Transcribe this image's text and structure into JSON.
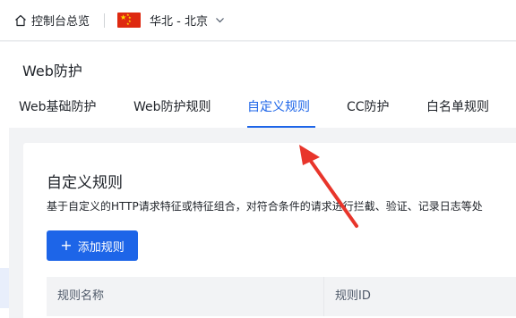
{
  "topbar": {
    "home_label": "控制台总览",
    "region_label": "华北 - 北京"
  },
  "page": {
    "title": "Web防护"
  },
  "tabs": [
    {
      "label": "Web基础防护",
      "active": false
    },
    {
      "label": "Web防护规则",
      "active": false
    },
    {
      "label": "自定义规则",
      "active": true
    },
    {
      "label": "CC防护",
      "active": false
    },
    {
      "label": "白名单规则",
      "active": false
    }
  ],
  "card": {
    "title": "自定义规则",
    "description": "基于自定义的HTTP请求特征或特征组合，对符合条件的请求进行拦截、验证、记录日志等处",
    "add_button_label": "添加规则",
    "columns": [
      "规则名称",
      "规则ID"
    ]
  },
  "colors": {
    "accent": "#1d65e8",
    "annotation_arrow": "#e8352b"
  },
  "icons": {
    "home": "home-icon",
    "flag": "china-flag-icon",
    "chevron": "chevron-down-icon",
    "plus": "plus-icon"
  }
}
